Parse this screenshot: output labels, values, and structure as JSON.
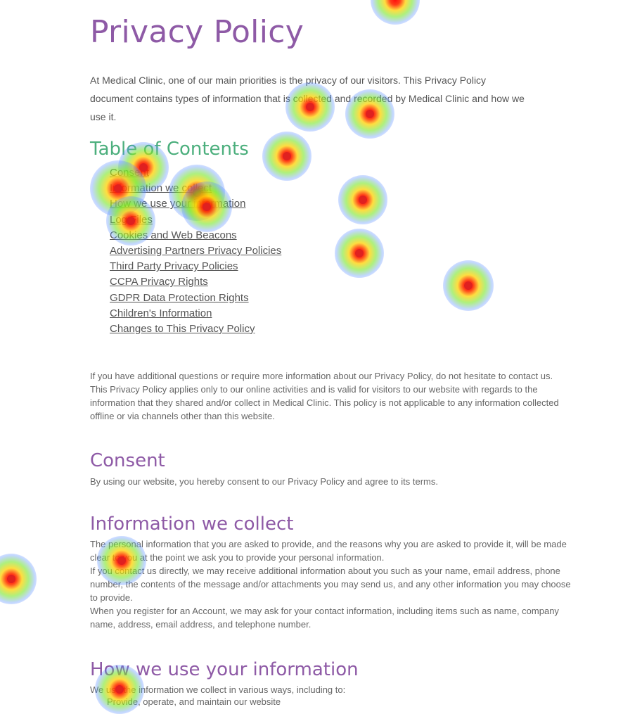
{
  "title": "Privacy Policy",
  "intro": "At Medical Clinic, one of our main priorities is the privacy of our visitors. This Privacy Policy document contains types of information that is collected and recorded by Medical Clinic and how we use it.",
  "toc": {
    "heading": "Table of Contents",
    "items": [
      "Consent",
      "Information we collect",
      "How we use your information",
      "Log Files",
      "Cookies and Web Beacons",
      "Advertising Partners Privacy Policies",
      "Third Party Privacy Policies",
      "CCPA Privacy Rights",
      "GDPR Data Protection Rights",
      "Children's Information",
      "Changes to This Privacy Policy"
    ]
  },
  "general": {
    "p1": "If you have additional questions or require more information about our Privacy Policy, do not hesitate to contact us.",
    "p2": "This Privacy Policy applies only to our online activities and is valid for visitors to our website with regards to the information that they shared and/or collect in Medical Clinic. This policy is not applicable to any information collected offline or via channels other than this website."
  },
  "consent": {
    "heading": "Consent",
    "p1": "By using our website, you hereby consent to our Privacy Policy and agree to its terms."
  },
  "collect": {
    "heading": "Information we collect",
    "p1": "The personal information that you are asked to provide, and the reasons why you are asked to provide it, will be made clear to you at the point we ask you to provide your personal information.",
    "p2": "If you contact us directly, we may receive additional information about you such as your name, email address, phone number, the contents of the message and/or attachments you may send us, and any other information you may choose to provide.",
    "p3": "When you register for an Account, we may ask for your contact information, including items such as name, company name, address, email address, and telephone number."
  },
  "use": {
    "heading": "How we use your information",
    "p1": "We use the information we collect in various ways, including to:",
    "items": [
      "Provide, operate, and maintain our website"
    ]
  }
}
